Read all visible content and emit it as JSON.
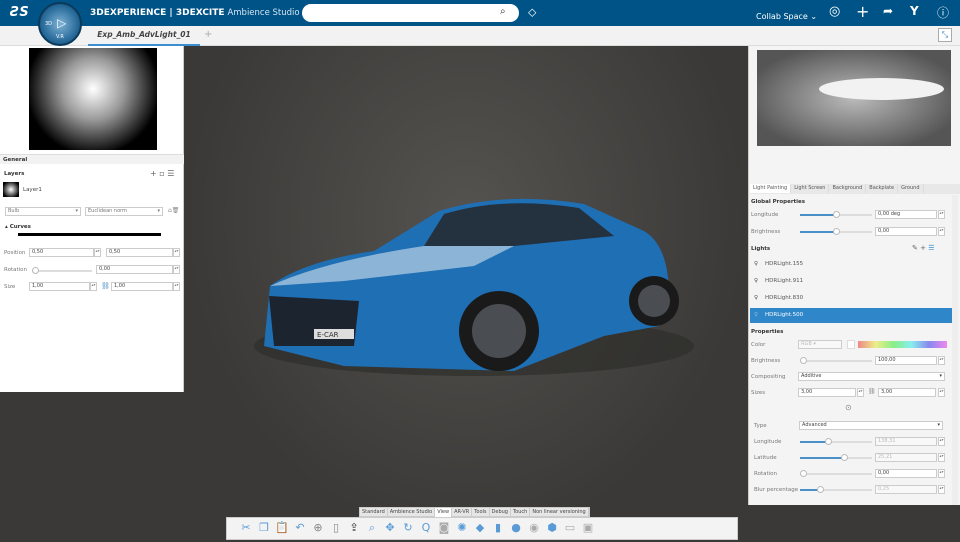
{
  "header": {
    "brand": "3DEXPERIENCE | 3DEXCITE",
    "app": "Ambience Studio",
    "compass_labels": [
      "3D",
      "V.R"
    ],
    "search_placeholder": "",
    "collab_space": "Collab Space"
  },
  "tabs": [
    {
      "label": "Exp_Amb_AdvLight_01",
      "active": true
    }
  ],
  "left_panel": {
    "general": "General",
    "layers_title": "Layers",
    "layer_name": "Layer1",
    "shape": "Bulb",
    "norm": "Euclidean norm",
    "curves": "Curves",
    "position_label": "Position",
    "position_x": "0,50",
    "position_y": "0,50",
    "rotation_label": "Rotation",
    "rotation": "0,00",
    "rotation_level": 0,
    "size_label": "Size",
    "size_x": "1,00",
    "size_y": "1,00"
  },
  "viewport": {
    "plate": "E-CAR"
  },
  "right_panel": {
    "tabs": [
      "Light Painting",
      "Light Screen",
      "Background",
      "Backplate",
      "Ground"
    ],
    "global_title": "Global Properties",
    "longitude_label": "Longitude",
    "longitude": "0,00 deg",
    "longitude_level": 0.5,
    "brightness_label": "Brightness",
    "brightness": "0,00",
    "brightness_level": 0.5,
    "lights_title": "Lights",
    "lights": [
      {
        "name": "HDRLight.155"
      },
      {
        "name": "HDRLight.911"
      },
      {
        "name": "HDRLight.830"
      },
      {
        "name": "HDRLight.500",
        "selected": true
      }
    ],
    "properties_title": "Properties",
    "color_label": "Color",
    "color_mode": "RGB",
    "p_brightness_label": "Brightness",
    "p_brightness": "100,00",
    "compositing_label": "Compositing",
    "compositing": "Additive",
    "sizes_label": "Sizes",
    "size_a": "3,00",
    "size_b": "3,00",
    "type_label": "Type",
    "type": "Advanced",
    "adv": [
      {
        "label": "Longitude",
        "value": "138,31",
        "level": 0.38,
        "disabled": true
      },
      {
        "label": "Latitude",
        "value": "25,21",
        "level": 0.62,
        "disabled": true
      },
      {
        "label": "Rotation",
        "value": "0,00",
        "level": 0,
        "disabled": false
      },
      {
        "label": "Blur percentage",
        "value": "0,25",
        "level": 0.25,
        "disabled": true
      }
    ]
  },
  "toolbar": {
    "tabs": [
      "Standard",
      "Ambience Studio",
      "View",
      "AR-VR",
      "Tools",
      "Debug",
      "Touch",
      "Non linear versioning"
    ],
    "active_tab": "View"
  },
  "colors": {
    "header": "#005386",
    "selected": "#2f86c8",
    "car": "#1f6fb5"
  }
}
